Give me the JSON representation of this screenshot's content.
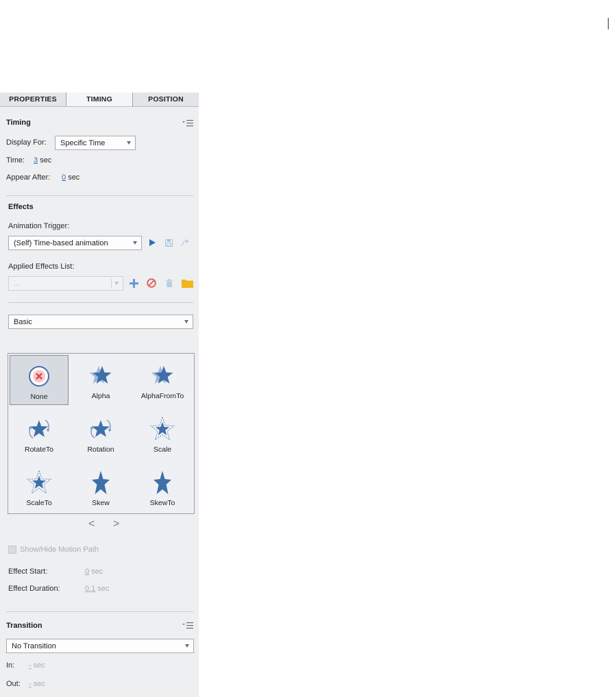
{
  "tabs": [
    {
      "label": "PROPERTIES"
    },
    {
      "label": "TIMING"
    },
    {
      "label": "POSITION"
    }
  ],
  "timing": {
    "title": "Timing",
    "display_for_label": "Display For:",
    "display_for_value": "Specific Time",
    "time_label": "Time:",
    "time_value": "3",
    "time_unit": "sec",
    "appear_after_label": "Appear After:",
    "appear_after_value": "0",
    "appear_after_unit": "sec"
  },
  "effects": {
    "title": "Effects",
    "trigger_label": "Animation Trigger:",
    "trigger_value": "(Self) Time-based animation",
    "applied_label": "Applied Effects List:",
    "applied_value": "...",
    "category_value": "Basic",
    "items": [
      {
        "label": "None",
        "icon": "none-effect-icon"
      },
      {
        "label": "Alpha",
        "icon": "alpha-star-icon"
      },
      {
        "label": "AlphaFromTo",
        "icon": "alpha-star-icon"
      },
      {
        "label": "RotateTo",
        "icon": "rotate-star-icon"
      },
      {
        "label": "Rotation",
        "icon": "rotate-star-icon"
      },
      {
        "label": "Scale",
        "icon": "scale-star-icon"
      },
      {
        "label": "ScaleTo",
        "icon": "scale-star-icon"
      },
      {
        "label": "Skew",
        "icon": "skew-star-icon"
      },
      {
        "label": "SkewTo",
        "icon": "skew-star-icon"
      }
    ],
    "prev_label": "<",
    "next_label": ">",
    "motion_path_label": "Show/Hide Motion Path",
    "effect_start_label": "Effect Start:",
    "effect_start_value": "0",
    "effect_start_unit": "sec",
    "effect_duration_label": "Effect Duration:",
    "effect_duration_value": "0.1",
    "effect_duration_unit": "sec"
  },
  "transition": {
    "title": "Transition",
    "value": "No Transition",
    "in_label": "In:",
    "in_value": "-",
    "in_unit": "sec",
    "out_label": "Out:",
    "out_value": "-",
    "out_unit": "sec"
  },
  "colors": {
    "accent_blue": "#2f6fb5",
    "star_blue": "#3f6fa8",
    "delete_red": "#e05a5a",
    "folder_yellow": "#f2b51c",
    "panel_bg": "#eeeff1"
  }
}
